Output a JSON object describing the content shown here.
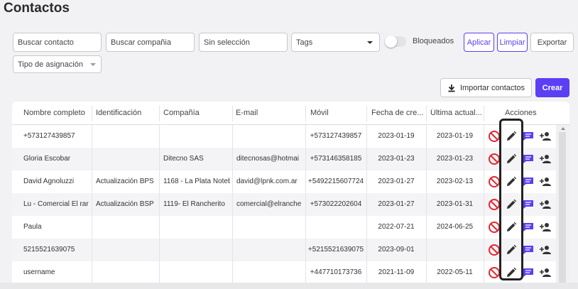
{
  "page": {
    "title": "Contactos"
  },
  "filters": {
    "contact_placeholder": "Buscar contacto",
    "company_placeholder": "Buscar compañia",
    "selection_value": "Sin selección",
    "tags_value": "Tags",
    "blocked_label": "Bloqueados",
    "blocked_on": false,
    "assignment_value": "Tipo de asignación"
  },
  "buttons": {
    "apply": "Aplicar",
    "clear": "Limpiar",
    "export": "Exportar",
    "import": "Importar contactos",
    "create": "Crear"
  },
  "colors": {
    "accent": "#5b3ff5",
    "block": "#e3262f",
    "chat": "#5b3ff5"
  },
  "icons": {
    "block": "block-icon",
    "edit": "edit-icon",
    "chat": "chat-icon",
    "assign": "assign-user-icon",
    "download": "download-icon"
  },
  "table": {
    "headers": [
      "Nombre completo",
      "Identificación",
      "Compañía",
      "E-mail",
      "Móvil",
      "Fecha de cre...",
      "Última actual...",
      "Acciones"
    ],
    "rows": [
      [
        "+573127439857",
        "",
        "",
        "",
        "+573127439857",
        "2023-01-19",
        "2023-01-19"
      ],
      [
        "Gloria Escobar",
        "",
        "Ditecno SAS",
        "ditecnosas@hotmai",
        "+573146358185",
        "2023-01-23",
        "2023-01-23"
      ],
      [
        "David Agnoluzzi",
        "Actualización BPS",
        "1168 - La Plata Noteb",
        "david@lpnk.com.ar",
        "+5492215607724",
        "2023-01-27",
        "2023-02-13"
      ],
      [
        "Lu - Comercial El rar",
        "Actualización BSP",
        "1119- El Rancherito",
        "comercial@elranche",
        "+573022202604",
        "2023-01-27",
        "2023-01-31"
      ],
      [
        "Paula",
        "",
        "",
        "",
        "",
        "2022-07-21",
        "2024-06-25"
      ],
      [
        "5215521639075",
        "",
        "",
        "",
        "+5215521639075",
        "2023-09-01",
        ""
      ],
      [
        "username",
        "",
        "",
        "",
        "+447710173736",
        "2021-11-09",
        "2022-05-11"
      ]
    ]
  }
}
